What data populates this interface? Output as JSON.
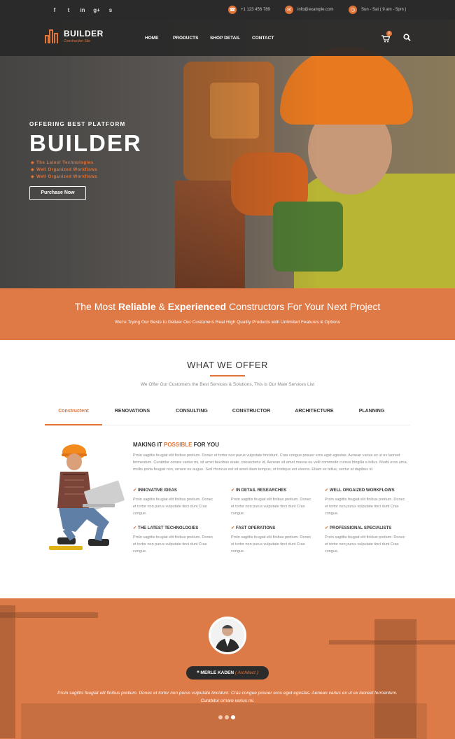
{
  "topbar": {
    "social_icons": [
      "facebook-icon",
      "twitter-icon",
      "linkedin-icon",
      "google-plus-icon",
      "skype-icon"
    ],
    "social_glyphs": [
      "f",
      "t",
      "in",
      "g+",
      "s"
    ],
    "phone": "+1 123 456 789",
    "email": "info@example.com",
    "hours": "Sun - Sat ( 9 am - 5pm )"
  },
  "nav": {
    "logo_title": "BUILDER",
    "logo_subtitle": "Construction Site",
    "items": [
      "HOME",
      "PRODUCTS",
      "SHOP DETAIL",
      "CONTACT"
    ],
    "cart_count": "0"
  },
  "hero": {
    "subtitle": "OFFERING BEST PLATFORM",
    "title": "BUILDER",
    "features": [
      "The Latest Technologies",
      "Well Organized Workflows",
      "Well Organized Workflows"
    ],
    "button": "Purchase Now"
  },
  "banner": {
    "title_pre": "The Most ",
    "title_b1": "Reliable",
    "title_mid": " & ",
    "title_b2": "Experienced",
    "title_post": " Constructors For Your Next Project",
    "subtitle": "We're Trying Our Bests to Deliver Our Customers Real High Quality Products with Unlimited Features & Options"
  },
  "offer": {
    "title": "WHAT WE OFFER",
    "subtitle": "We Offer Our Customers the Best Services & Solutions, This is Our Main Services List",
    "tabs": [
      "Constructent",
      "RENOVATIONS",
      "CONSULTING",
      "CONSTRUCTOR",
      "ARCHITECTURE",
      "PLANNING"
    ],
    "heading_pre": "MAKING IT ",
    "heading_hl": "POSSIBLE",
    "heading_post": " FOR YOU",
    "paragraph": "Proin sagittis feugiat elit finibus pretium. Donec et tortor non purus vulputate tincidunt. Cras congue posuer eros eget egestas. Aenean varius ex ut ex laoreet fermentum. Curabitur ornare varius mi, sit amet faucibus erate, consectetur id. Aenean sit amet massa eu velit commodo cursus fringilla a tellus. Morbi eros urna, mollis porta feugiat non, ornare eu augue. Sed rhoncus est sit amet diam tempus, et tristique est viverra. Etiam ex tellus, sectur at dapibus id.",
    "features": [
      {
        "title": "INNOVATIVE IDEAS",
        "text": "Proin sagittis feugiat elit finibus pretium. Donec et tortor non purus vulputate tinci dunt Cras congue."
      },
      {
        "title": "IN DETAIL RESEARCHES",
        "text": "Proin sagittis feugiat elit finibus pretium. Donec et tortor non purus vulputate tinci dunt Cras congue."
      },
      {
        "title": "WELL ORGAIZED WORKFLOWS",
        "text": "Proin sagittis feugiat elit finibus pretium. Donec et tortor non purus vulputate tinci dunt Cras congue."
      },
      {
        "title": "THE LATEST TECHNOLOGIES",
        "text": "Proin sagittis feugiat elit finibus pretium. Donec et tortor non purus vulputate tinci dunt Cras congue."
      },
      {
        "title": "FAST OPERATIONS",
        "text": "Proin sagittis feugiat elit finibus pretium. Donec et tortor non purus vulputate tinci dunt Cras congue."
      },
      {
        "title": "PROFESSIONAL SPECIALISTS",
        "text": "Proin sagittis feugiat elit finibus pretium. Donec et tortor non purus vulputate tinci dunt Cras congue."
      }
    ]
  },
  "testimonial": {
    "name": "MERLE KADEN",
    "role": "( Architect )",
    "quote": "Proin sagittis feugiat elit finibus pretium. Donec et tortor non purus vulputate tincidunt. Cras congue posuer eros eget egestas. Aenean varius ex ut ex laoreet fermentum. Curabitur ornare varius mi.",
    "slides": 3,
    "active_slide": 3
  },
  "colors": {
    "accent": "#e07338",
    "dark": "#2a2a2a",
    "banner": "#df7a47"
  }
}
